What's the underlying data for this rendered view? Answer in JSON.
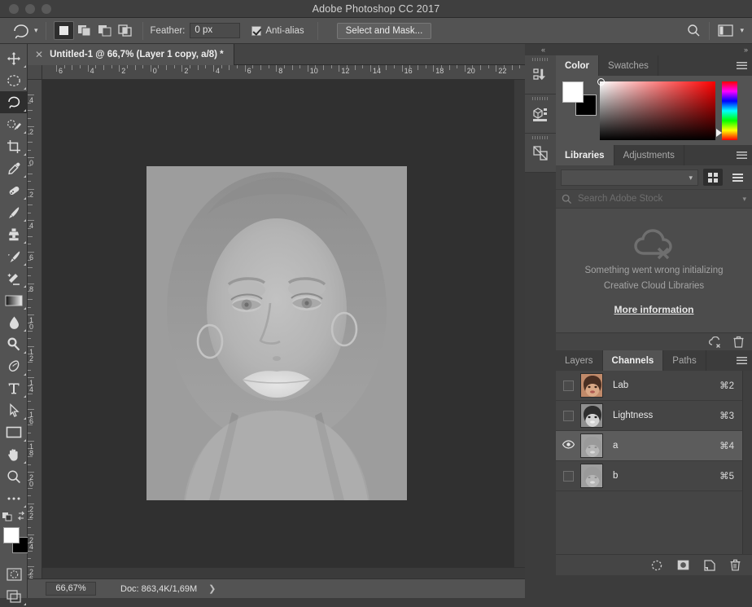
{
  "window": {
    "title": "Adobe Photoshop CC 2017"
  },
  "options_bar": {
    "tool_icon": "lasso-icon",
    "preset_chevron": "chevron-down-icon",
    "selection_modes": [
      {
        "name": "new-selection",
        "icon": "new-selection-icon",
        "active": true
      },
      {
        "name": "add-to-selection",
        "icon": "add-selection-icon",
        "active": false
      },
      {
        "name": "subtract-from-selection",
        "icon": "subtract-selection-icon",
        "active": false
      },
      {
        "name": "intersect-selection",
        "icon": "intersect-selection-icon",
        "active": false
      }
    ],
    "feather_label": "Feather:",
    "feather_value": "0 px",
    "antialias_label": "Anti-alias",
    "antialias_checked": true,
    "select_and_mask_label": "Select and Mask...",
    "search_icon": "search-icon",
    "workspace_icon": "workspace-icon",
    "workspace_chevron": "chevron-down-icon"
  },
  "toolbar": {
    "tools": [
      {
        "name": "move-tool",
        "icon": "move-icon",
        "active": false
      },
      {
        "name": "marquee-tool",
        "icon": "elliptical-marquee-icon",
        "active": false
      },
      {
        "name": "lasso-tool",
        "icon": "lasso-icon",
        "active": true
      },
      {
        "name": "quick-selection-tool",
        "icon": "quick-selection-icon",
        "active": false
      },
      {
        "name": "crop-tool",
        "icon": "crop-icon",
        "active": false
      },
      {
        "name": "eyedropper-tool",
        "icon": "eyedropper-icon",
        "active": false
      },
      {
        "name": "healing-brush-tool",
        "icon": "healing-brush-icon",
        "active": false
      },
      {
        "name": "brush-tool",
        "icon": "brush-icon",
        "active": false
      },
      {
        "name": "clone-stamp-tool",
        "icon": "clone-stamp-icon",
        "active": false
      },
      {
        "name": "history-brush-tool",
        "icon": "history-brush-icon",
        "active": false
      },
      {
        "name": "eraser-tool",
        "icon": "eraser-icon",
        "active": false
      },
      {
        "name": "gradient-tool",
        "icon": "gradient-icon",
        "active": false
      },
      {
        "name": "blur-tool",
        "icon": "blur-droplet-icon",
        "active": false
      },
      {
        "name": "dodge-tool",
        "icon": "dodge-icon",
        "active": false
      },
      {
        "name": "pen-tool",
        "icon": "pen-icon",
        "active": false
      },
      {
        "name": "type-tool",
        "icon": "type-icon",
        "active": false
      },
      {
        "name": "path-selection-tool",
        "icon": "path-selection-arrow-icon",
        "active": false
      },
      {
        "name": "rectangle-tool",
        "icon": "rectangle-shape-icon",
        "active": false
      },
      {
        "name": "hand-tool",
        "icon": "hand-icon",
        "active": false
      },
      {
        "name": "zoom-tool",
        "icon": "zoom-magnifier-icon",
        "active": false
      },
      {
        "name": "more-tools",
        "icon": "ellipsis-icon",
        "active": false
      }
    ],
    "swap_colors_icon": "swap-colors-icon",
    "default_colors_icon": "default-colors-icon",
    "foreground_color": "#ffffff",
    "background_color": "#000000",
    "quick_mask_icon": "quick-mask-icon",
    "screen_mode_icon": "screen-mode-icon"
  },
  "document": {
    "tab_title": "Untitled-1 @ 66,7% (Layer 1 copy, a/8) *",
    "close_icon": "close-icon"
  },
  "rulers": {
    "horizontal_labels": [
      "6",
      "4",
      "2",
      "0",
      "2",
      "4",
      "6",
      "8",
      "10",
      "12",
      "14",
      "16",
      "18",
      "20",
      "22"
    ],
    "vertical_labels": [
      "4",
      "2",
      "0",
      "2",
      "4",
      "6",
      "8",
      "10",
      "12",
      "14",
      "16",
      "18",
      "20",
      "22",
      "24",
      "26"
    ]
  },
  "status_bar": {
    "zoom_value": "66,67%",
    "doc_info": "Doc: 863,4K/1,69M",
    "expand_icon": "chevron-right-icon"
  },
  "dock": {
    "collapse_left_icon": "collapse-left-icon",
    "expand_right_icon": "expand-right-icon",
    "rail_buttons": [
      {
        "name": "history-panel-icon",
        "label": "History"
      },
      {
        "name": "3d-panel-icon",
        "label": "3D"
      },
      {
        "name": "layer-comps-panel-icon",
        "label": "Layer Comps"
      }
    ]
  },
  "color_panel": {
    "tabs": [
      {
        "label": "Color",
        "active": true
      },
      {
        "label": "Swatches",
        "active": false
      }
    ],
    "menu_icon": "panel-menu-icon",
    "foreground_color": "#ffffff",
    "background_color": "#000000",
    "picker_base_hue": "#ff0000"
  },
  "libraries_panel": {
    "tabs": [
      {
        "label": "Libraries",
        "active": true
      },
      {
        "label": "Adjustments",
        "active": false
      }
    ],
    "menu_icon": "panel-menu-icon",
    "library_select_value": "",
    "select_chevron": "chevron-down-icon",
    "grid_view_icon": "grid-view-icon",
    "list_view_icon": "list-view-icon",
    "search_icon": "search-icon",
    "search_placeholder": "Search Adobe Stock",
    "search_chevron": "chevron-down-icon",
    "error_icon": "cloud-error-icon",
    "error_line1": "Something went wrong initializing",
    "error_line2": "Creative Cloud Libraries",
    "more_information_label": "More information",
    "footer_icons": [
      {
        "name": "sync-error-icon"
      },
      {
        "name": "delete-icon"
      }
    ]
  },
  "channels_panel": {
    "tabs": [
      {
        "label": "Layers",
        "active": false
      },
      {
        "label": "Channels",
        "active": true
      },
      {
        "label": "Paths",
        "active": false
      }
    ],
    "menu_icon": "panel-menu-icon",
    "rows": [
      {
        "name": "Lab",
        "shortcut": "⌘2",
        "visible": false,
        "selected": false,
        "thumb": "color"
      },
      {
        "name": "Lightness",
        "shortcut": "⌘3",
        "visible": false,
        "selected": false,
        "thumb": "gray"
      },
      {
        "name": "a",
        "shortcut": "⌘4",
        "visible": true,
        "selected": true,
        "thumb": "faint"
      },
      {
        "name": "b",
        "shortcut": "⌘5",
        "visible": false,
        "selected": false,
        "thumb": "faint"
      }
    ],
    "footer_icons": [
      {
        "name": "load-channel-as-selection-icon"
      },
      {
        "name": "save-selection-as-channel-icon"
      },
      {
        "name": "new-channel-icon"
      },
      {
        "name": "delete-channel-icon"
      }
    ]
  }
}
